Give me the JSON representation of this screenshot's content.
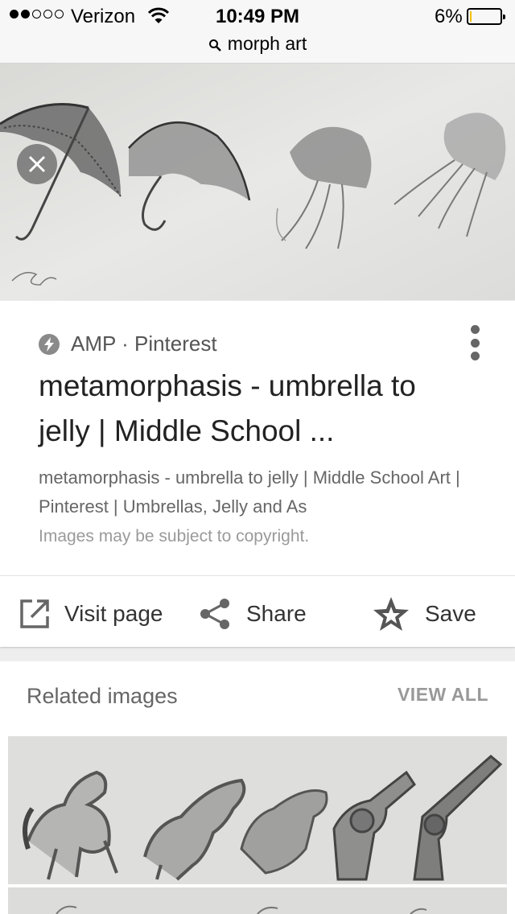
{
  "status_bar": {
    "carrier": "Verizon",
    "time": "10:49 PM",
    "battery": "6%",
    "battery_level": 0.06
  },
  "address_bar": {
    "query": "morph art",
    "icon": "search-icon"
  },
  "hero": {
    "close_icon": "close-icon"
  },
  "result": {
    "source": "AMP · Pinterest",
    "title": "metamorphasis - umbrella to jelly | Middle School ...",
    "description": "metamorphasis - umbrella to jelly | Middle School Art | Pinterest | Umbrellas, Jelly and As",
    "copyright_note": "Images may be subject to copyright."
  },
  "actions": {
    "visit_label": "Visit page",
    "share_label": "Share",
    "save_label": "Save"
  },
  "related": {
    "title": "Related images",
    "view_all": "VIEW ALL"
  },
  "colors": {
    "battery_fill": "#f2c100",
    "icon_gray": "#666666"
  }
}
